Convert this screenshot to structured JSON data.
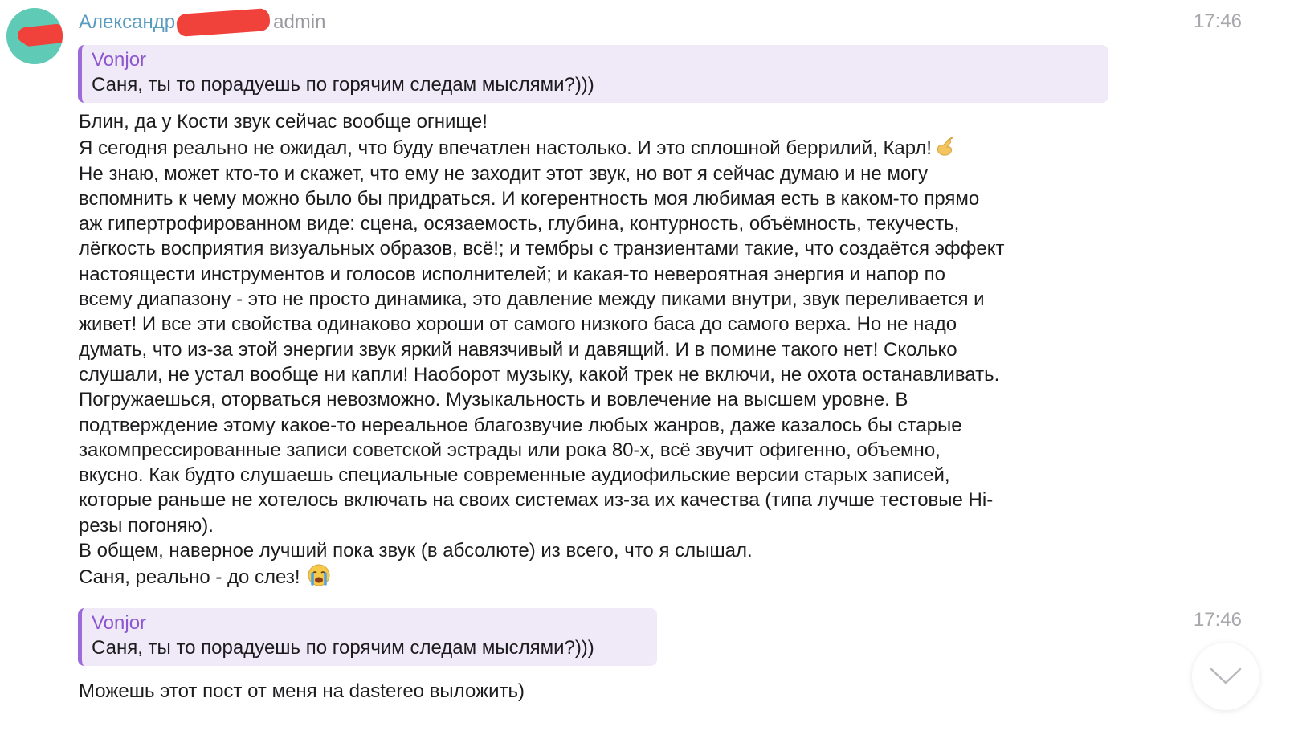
{
  "message1": {
    "author": "Александр",
    "role": "admin",
    "time": "17:46",
    "reply": {
      "author": "Vonjor",
      "text": "Саня, ты то порадуешь по горячим следам мыслями?)))"
    },
    "lines": [
      "Блин, да у Кости звук сейчас вообще огнище!",
      "Я сегодня реально не ожидал, что буду впечатлен настолько. И это сплошной беррилий, Карл!",
      "Не знаю, может кто-то и скажет, что ему не заходит этот звук, но вот я сейчас думаю и не могу",
      "вспомнить к чему можно было бы придраться. И когерентность моя любимая есть в каком-то прямо",
      "аж гипертрофированном виде: сцена, осязаемость, глубина, контурность, объёмность, текучесть,",
      "лёгкость восприятия визуальных образов, всё!; и тембры с транзиентами такие, что создаётся эффект",
      "настоящести инструментов и голосов исполнителей; и какая-то невероятная энергия и напор по",
      "всему диапазону - это не просто динамика, это давление между пиками внутри, звук переливается и",
      "живет! И все эти свойства одинаково хороши от самого низкого баса до самого верха. Но не надо",
      "думать, что из-за этой энергии звук яркий навязчивый и давящий. И в помине такого нет! Сколько",
      "слушали, не устал вообще ни капли! Наоборот музыку, какой трек не включи, не охота останавливать.",
      "Погружаешься, оторваться невозможно.  Музыкальность и вовлечение на высшем уровне. В",
      "подтверждение этому какое-то нереальное благозвучие любых жанров, даже казалось бы старые",
      "закомпрессированные записи советской эстрады или рока 80-х, всё звучит офигенно, объемно,",
      "вкусно. Как будто слушаешь специальные современные аудиофильские версии старых записей,",
      "которые раньше не хотелось включать на своих системах из-за их качества (типа лучше тестовые Hi-",
      "резы погоняю).",
      "В общем, наверное лучший пока звук (в абсолюте) из всего, что я слышал.",
      "Саня, реально - до слез!"
    ],
    "emoji_line2": "pinching-hand-icon",
    "emoji_last": "crying-face-icon"
  },
  "message2": {
    "time": "17:46",
    "reply": {
      "author": "Vonjor",
      "text": "Саня, ты то порадуешь по горячим следам мыслями?)))"
    },
    "text": "Можешь этот пост от меня на dastereo выложить)"
  },
  "colors": {
    "author_name": "#5a9bc0",
    "reply_author": "#8d57d0",
    "reply_bar": "#9d6ad8",
    "reply_bg": "#efe9f8",
    "avatar": "#5fcab5",
    "redaction": "#f0423a"
  },
  "scroll_button_icon": "chevron-down-icon"
}
